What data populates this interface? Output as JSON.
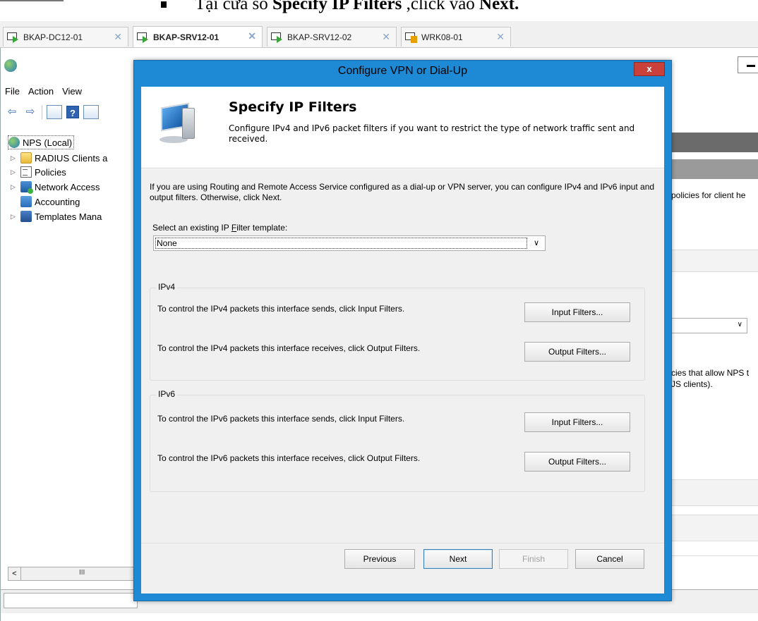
{
  "caption": {
    "prefix": "Tại cửa sổ ",
    "bold1": "Specify IP Filters",
    "middle": " ,click vào ",
    "bold2": "Next."
  },
  "tabs": [
    {
      "label": "BKAP-DC12-01",
      "state": "running",
      "active": false
    },
    {
      "label": "BKAP-SRV12-01",
      "state": "running",
      "active": true
    },
    {
      "label": "BKAP-SRV12-02",
      "state": "running",
      "active": false
    },
    {
      "label": "WRK08-01",
      "state": "paused",
      "active": false
    }
  ],
  "mmc": {
    "menu": [
      "File",
      "Action",
      "View"
    ],
    "tree": [
      {
        "label": "NPS (Local)",
        "icon": "globe-icon",
        "expandable": false
      },
      {
        "label": "RADIUS Clients a",
        "icon": "folder-icon",
        "expandable": true
      },
      {
        "label": "Policies",
        "icon": "document-icon",
        "expandable": true
      },
      {
        "label": "Network Access",
        "icon": "network-access-icon",
        "expandable": true
      },
      {
        "label": "Accounting",
        "icon": "accounting-icon",
        "expandable": false
      },
      {
        "label": "Templates Mana",
        "icon": "templates-icon",
        "expandable": true
      }
    ],
    "scroll_thumb": "III",
    "right_pane": {
      "text1": "policies for client he",
      "text2": "cies that allow NPS t",
      "text3": "JS clients)."
    }
  },
  "dialog": {
    "title": "Configure VPN or Dial-Up",
    "close_label": "x",
    "header_title": "Specify IP Filters",
    "header_subtitle": "Configure IPv4 and IPv6 packet filters if you want to restrict the type of network traffic sent and received.",
    "intro": "If you are using Routing and Remote Access Service configured as a dial-up or VPN server, you can configure IPv4 and IPv6 input and output filters. Otherwise, click Next.",
    "template_label_pre": "Select an existing IP ",
    "template_label_accel": "F",
    "template_label_post": "ilter template:",
    "template_value": "None",
    "ipv4": {
      "legend": "IPv4",
      "input_text": "To control the IPv4 packets this interface sends, click Input Filters.",
      "output_text": "To control the IPv4 packets this interface receives, click Output Filters.",
      "input_button": "Input Filters...",
      "output_button": "Output Filters..."
    },
    "ipv6": {
      "legend": "IPv6",
      "input_text": "To control the IPv6 packets this interface sends, click Input Filters.",
      "output_text": "To control the IPv6 packets this interface receives, click Output Filters.",
      "input_button": "Input Filters...",
      "output_button": "Output Filters..."
    },
    "buttons": {
      "previous": "Previous",
      "next": "Next",
      "finish": "Finish",
      "cancel": "Cancel"
    }
  }
}
